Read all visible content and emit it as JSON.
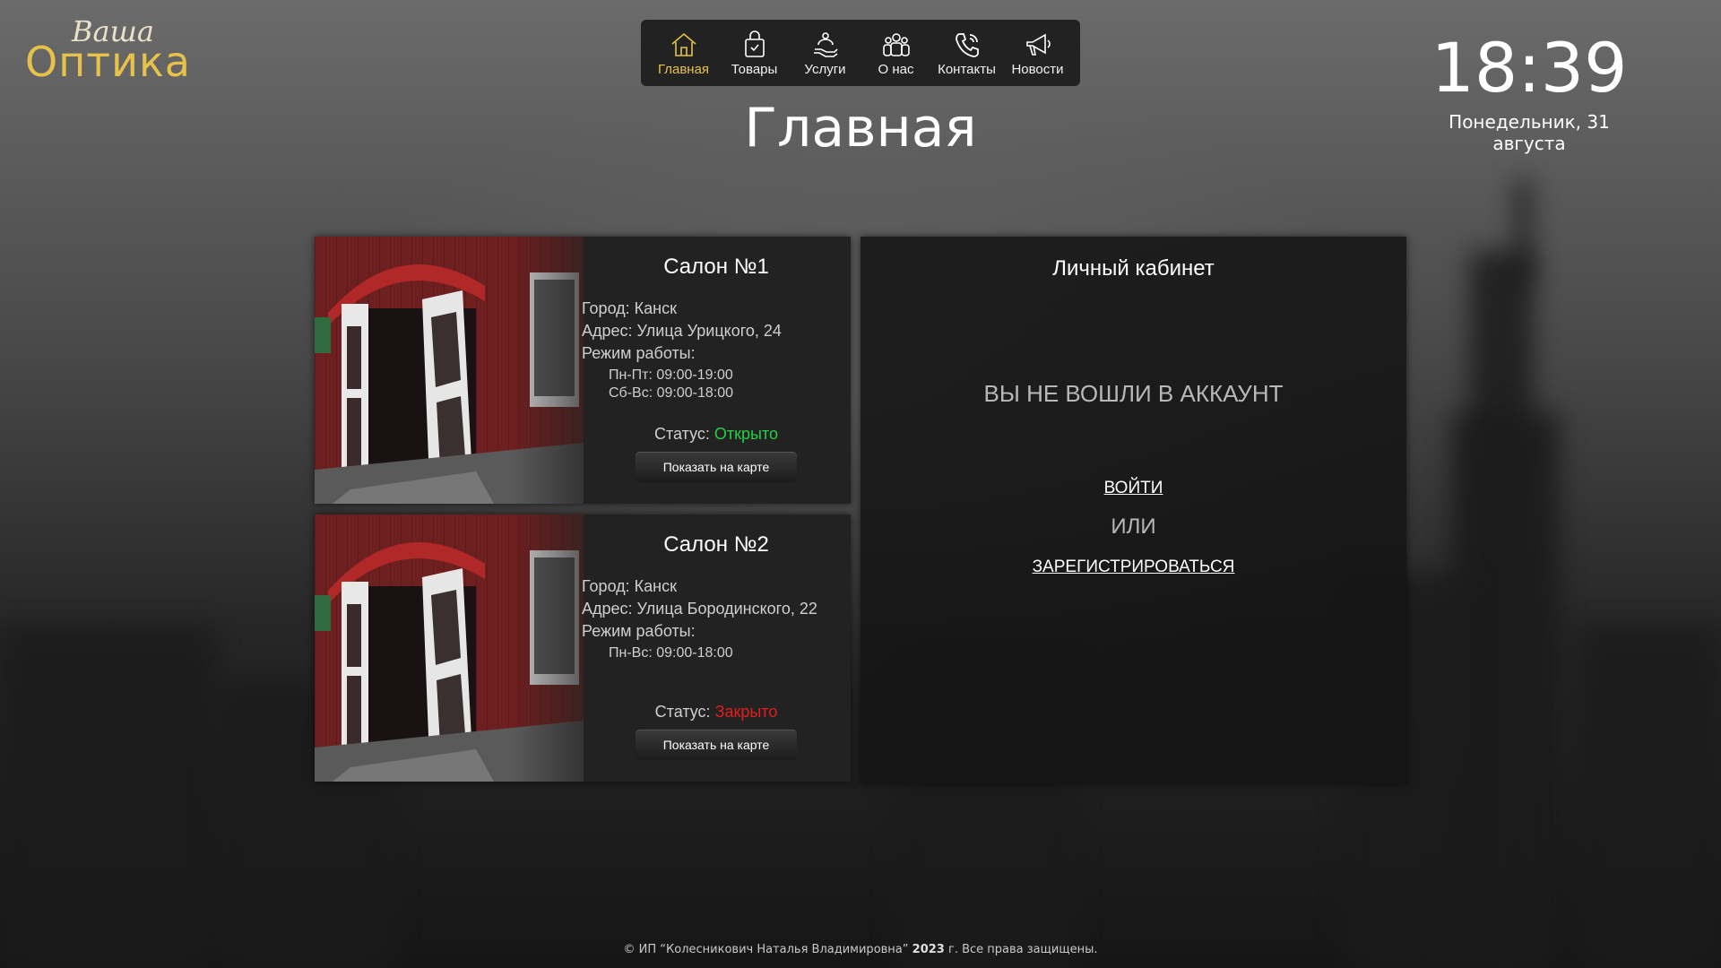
{
  "logo": {
    "script": "Ваша",
    "main": "Оптика"
  },
  "nav": [
    {
      "label": "Главная",
      "icon": "home-icon",
      "active": true
    },
    {
      "label": "Товары",
      "icon": "shopping-bag-icon",
      "active": false
    },
    {
      "label": "Услуги",
      "icon": "service-hand-icon",
      "active": false
    },
    {
      "label": "О нас",
      "icon": "team-icon",
      "active": false
    },
    {
      "label": "Контакты",
      "icon": "phone-icon",
      "active": false
    },
    {
      "label": "Новости",
      "icon": "megaphone-icon",
      "active": false
    }
  ],
  "page_title": "Главная",
  "clock": {
    "time": "18:39",
    "date": "Понедельник, 31 августа"
  },
  "salons": [
    {
      "title": "Салон №1",
      "city": "Город: Канск",
      "address": "Адрес: Улица Урицкого, 24",
      "hours_label": "Режим работы:",
      "hours": [
        "Пн-Пт: 09:00-19:00",
        "Сб-Вс: 09:00-18:00"
      ],
      "status_label": "Статус:",
      "status": "Открыто",
      "map_button": "Показать на карте"
    },
    {
      "title": "Салон №2",
      "city": "Город: Канск",
      "address": "Адрес: Улица Бородинского, 22",
      "hours_label": "Режим работы:",
      "hours": [
        "Пн-Вс: 09:00-18:00"
      ],
      "status_label": "Статус:",
      "status": "Закрыто",
      "map_button": "Показать на карте"
    }
  ],
  "account": {
    "title": "Личный кабинет",
    "notice": "ВЫ НЕ ВОШЛИ В АККАУНТ",
    "login": "ВОЙТИ",
    "or": "ИЛИ",
    "register": "ЗАРЕГИСТРИРОВАТЬСЯ"
  },
  "footer": {
    "prefix": "© ИП “Колесникович Наталья Владимировна”",
    "year": "2023",
    "suffix": "г. Все права защищены."
  },
  "colors": {
    "accent": "#e7c24a",
    "open": "#22d143",
    "closed": "#e41d1d"
  }
}
